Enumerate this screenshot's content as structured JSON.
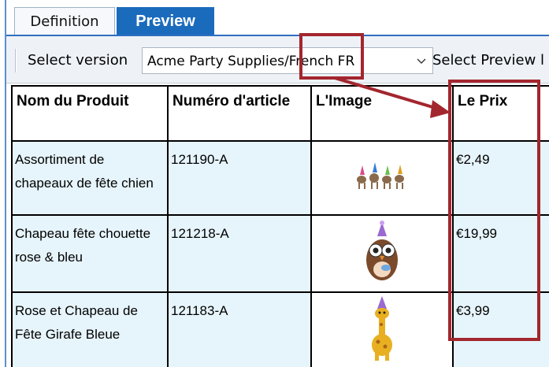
{
  "tabs": [
    {
      "label": "Definition",
      "active": false
    },
    {
      "label": "Preview",
      "active": true
    }
  ],
  "toolbar": {
    "select_version_label": "Select version",
    "version_value": "Acme Party Supplies/French FR",
    "select_preview_label": "Select Preview l"
  },
  "table": {
    "headers": [
      "Nom du Produit",
      "Numéro d'article",
      "L'Image",
      "Le Prix"
    ],
    "rows": [
      {
        "name": "Assortiment de chapeaux de fête chien",
        "article": "121190-A",
        "image": "dog-party-hats",
        "price": "€2,49"
      },
      {
        "name": "Chapeau fête chouette rose & bleu",
        "article": "121218-A",
        "image": "owl-party-hat",
        "price": "€19,99"
      },
      {
        "name": "Rose et Chapeau de Fête Girafe Bleue",
        "article": "121183-A",
        "image": "giraffe-party-hat",
        "price": "€3,99"
      }
    ]
  },
  "colors": {
    "tab_active": "#1b6bbd",
    "cell_background": "#e6f4fb",
    "annotation": "#a3262e"
  }
}
